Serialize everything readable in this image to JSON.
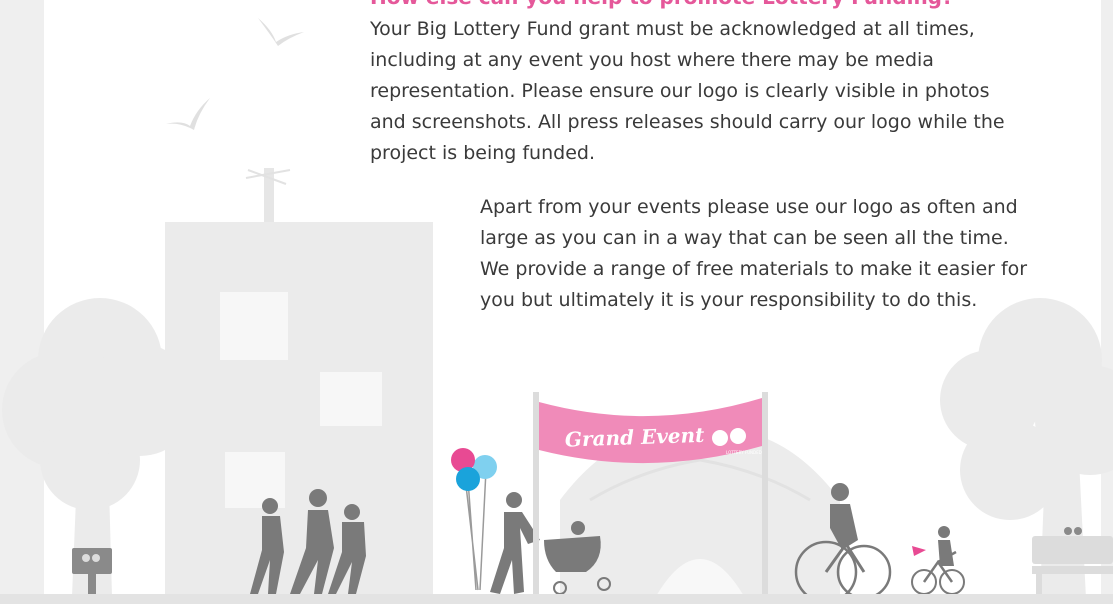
{
  "content": {
    "heading": "How else can you help to promote Lottery Funding?",
    "paragraph_1": "Your Big Lottery Fund grant must be acknowledged at all times, including at any event you host where there may be media representation. Please ensure our logo is clearly visible in photos and screenshots. All press releases should carry our logo while the project is being funded.",
    "paragraph_2": "Apart from your events please use our logo as often and large as you can in a way that can be seen all the time. We provide a range of free materials to make it easier for you but ultimately it is your responsibility to do this."
  },
  "banner": {
    "text": "Grand Event",
    "logo_caption": "LOTTERY FUNDED"
  },
  "colors": {
    "heading": "#e5589a",
    "body_text": "#3a3a3a",
    "scenery": "#ebebeb",
    "silhouette": "#7a7a7a",
    "banner": "#f08bb9",
    "balloon_pink": "#e84a93",
    "balloon_blue": "#1aa3db",
    "balloon_cyan": "#7fd0ef"
  }
}
